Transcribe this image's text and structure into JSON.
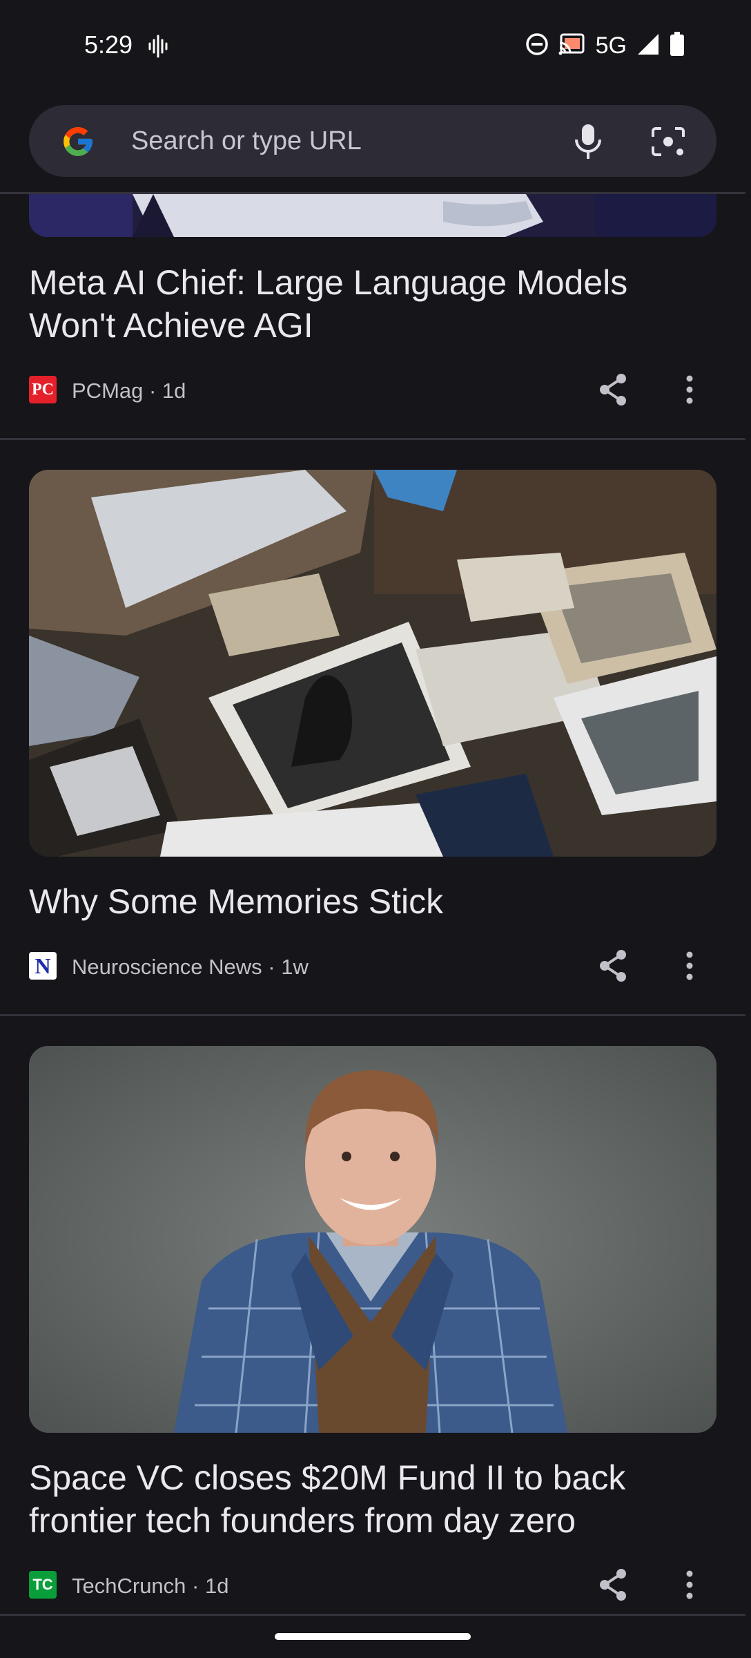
{
  "status_bar": {
    "time": "5:29",
    "network": "5G",
    "icons": [
      "voice-activity-icon",
      "do-not-disturb-icon",
      "cast-icon",
      "signal-icon",
      "battery-icon"
    ]
  },
  "search": {
    "placeholder": "Search or type URL",
    "icons": [
      "google-logo-icon",
      "mic-icon",
      "lens-camera-icon"
    ]
  },
  "articles": [
    {
      "title": "Meta AI Chief: Large Language Models Won't Achieve AGI",
      "source": "PCMag",
      "age": "1d",
      "source_line": "PCMag · 1d",
      "logo_text": "PC",
      "logo_color": "#e4212b"
    },
    {
      "title": "Why Some Memories Stick",
      "source": "Neuroscience News",
      "age": "1w",
      "source_line": "Neuroscience News · 1w",
      "logo_text": "N",
      "logo_color": "#1c2fa8"
    },
    {
      "title": "Space VC closes $20M Fund II to back frontier tech founders from day zero",
      "source": "TechCrunch",
      "age": "1d",
      "source_line": "TechCrunch · 1d",
      "logo_text": "TC",
      "logo_color": "#0a9e3a"
    }
  ],
  "colors": {
    "background": "#16151a",
    "search_bar": "#2d2b36",
    "text_primary": "#ebe7ee",
    "text_secondary": "#c4c0c9"
  }
}
